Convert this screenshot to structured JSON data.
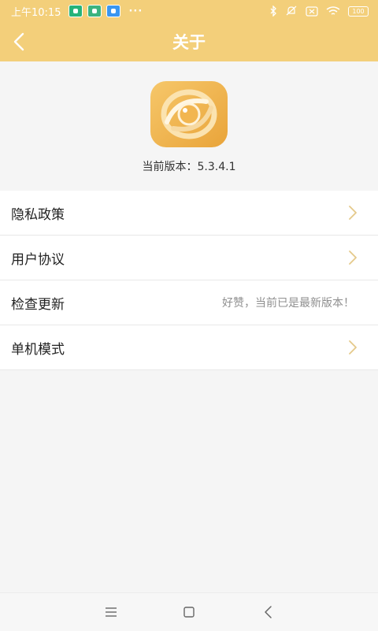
{
  "status_bar": {
    "time": "上午10:15",
    "dots": "···",
    "battery": "100"
  },
  "header": {
    "title": "关于"
  },
  "app_info": {
    "version_text": "当前版本：5.3.4.1"
  },
  "menu": {
    "items": [
      {
        "label": "隐私政策"
      },
      {
        "label": "用户协议"
      },
      {
        "label": "检查更新",
        "value": "好赞，当前已是最新版本！"
      },
      {
        "label": "单机模式"
      }
    ]
  },
  "colors": {
    "accent": "#f3cf7a",
    "app_icon_orange": "#efb04a",
    "arrow": "#e4c98a"
  },
  "icons": {
    "back": "chevron-left-icon",
    "app": "app-logo-icon",
    "row_arrow": "chevron-right-icon",
    "sys_menu": "menu-lines-icon",
    "sys_home": "square-home-icon",
    "sys_back": "chevron-left-icon"
  }
}
